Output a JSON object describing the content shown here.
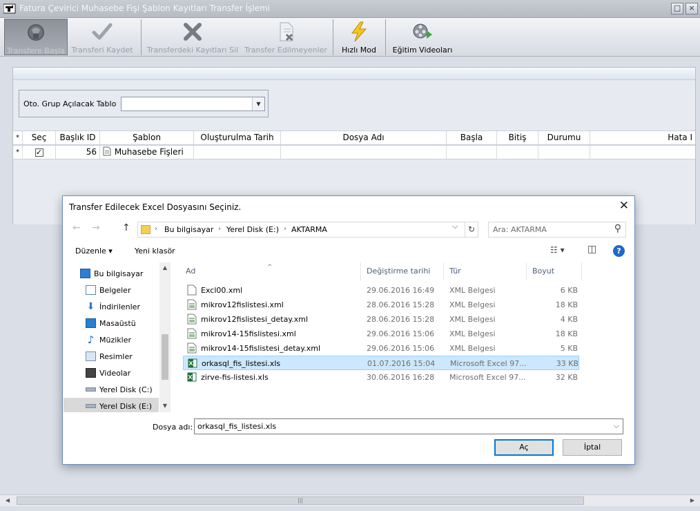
{
  "app": {
    "title": "Fatura Çevirici Muhasebe Fişi Şablon Kayıtları Transfer İşlemi",
    "restore_glyph": "□",
    "close_glyph": "×"
  },
  "toolbar": {
    "start_label": "Transfere Başla",
    "save_label": "Transferi Kaydet",
    "delete_label": "Transferdeki Kayıtları Sil",
    "not_transferred_label": "Transfer Edilmeyenler",
    "fast_mode_label": "Hızlı Mod",
    "videos_label": "Eğitim Videoları"
  },
  "filter": {
    "label": "Oto. Grup Açılacak Tablo",
    "value": "",
    "arrow_glyph": "▼"
  },
  "grid": {
    "columns": [
      "*",
      "Seç",
      "Başlık ID",
      "Şablon",
      "Oluşturulma Tarih",
      "Dosya Adı",
      "Başla",
      "Bitiş",
      "Durumu",
      "Hata I"
    ],
    "rows": [
      {
        "marker": "*",
        "checked": "✓",
        "id": "56",
        "template": "Muhasebe Fişleri",
        "created": "",
        "file": "",
        "start": "",
        "end": "",
        "status": "",
        "error": ""
      }
    ]
  },
  "app_scroll": {
    "left": "◀",
    "right": "▶",
    "grip": "|||"
  },
  "dialog": {
    "title": "Transfer Edilecek Excel Dosyasını Seçiniz.",
    "close_glyph": "✕",
    "nav": {
      "back": "←",
      "forward": "→",
      "up": "↑",
      "dropdown": "⌵",
      "refresh": "↻"
    },
    "breadcrumb": [
      "Bu bilgisayar",
      "Yerel Disk (E:)",
      "AKTARMA"
    ],
    "breadcrumb_sep": "›",
    "search_placeholder": "Ara: AKTARMA",
    "search_glyph": "⚲",
    "commands": {
      "organize": "Düzenle ▾",
      "new_folder": "Yeni klasör",
      "view": "☷ ▾",
      "pane": "◫",
      "help": "?"
    },
    "tree": [
      {
        "label": "Bu bilgisayar",
        "icon": "computer-icon",
        "color": "#2a7fd4"
      },
      {
        "label": "Belgeler",
        "icon": "documents-icon",
        "color": "#5a86b8"
      },
      {
        "label": "İndirilenler",
        "icon": "downloads-icon",
        "color": "#2a7fd4"
      },
      {
        "label": "Masaüstü",
        "icon": "desktop-icon",
        "color": "#2a7fd4"
      },
      {
        "label": "Müzikler",
        "icon": "music-icon",
        "color": "#1e69c8"
      },
      {
        "label": "Resimler",
        "icon": "pictures-icon",
        "color": "#6d8fb5"
      },
      {
        "label": "Videolar",
        "icon": "videos-icon",
        "color": "#444444"
      },
      {
        "label": "Yerel Disk (C:)",
        "icon": "drive-c-icon",
        "color": "#7a8899"
      },
      {
        "label": "Yerel Disk (E:)",
        "icon": "drive-e-icon",
        "color": "#7a8899"
      }
    ],
    "tree_scroll": {
      "up": "▲",
      "down": "▼"
    },
    "columns": {
      "name": "Ad",
      "modified": "Değiştirme tarihi",
      "type": "Tür",
      "size": "Boyut",
      "sort_caret": "^"
    },
    "files": [
      {
        "name": "Excl00.xml",
        "modified": "29.06.2016 16:49",
        "type": "XML Belgesi",
        "size": "6 KB",
        "kind": "xml"
      },
      {
        "name": "mikrov12fislistesi.xml",
        "modified": "28.06.2016 15:28",
        "type": "XML Belgesi",
        "size": "18 KB",
        "kind": "xml"
      },
      {
        "name": "mikrov12fislistesi_detay.xml",
        "modified": "28.06.2016 15:28",
        "type": "XML Belgesi",
        "size": "4 KB",
        "kind": "xml"
      },
      {
        "name": "mikrov14-15fislistesi.xml",
        "modified": "29.06.2016 15:06",
        "type": "XML Belgesi",
        "size": "18 KB",
        "kind": "xml"
      },
      {
        "name": "mikrov14-15fislistesi_detay.xml",
        "modified": "29.06.2016 15:06",
        "type": "XML Belgesi",
        "size": "5 KB",
        "kind": "xml"
      },
      {
        "name": "orkasql_fis_listesi.xls",
        "modified": "01.07.2016 15:04",
        "type": "Microsoft Excel 97...",
        "size": "33 KB",
        "kind": "xls"
      },
      {
        "name": "zirve-fis-listesi.xls",
        "modified": "30.06.2016 16:28",
        "type": "Microsoft Excel 97...",
        "size": "32 KB",
        "kind": "xls"
      }
    ],
    "filename_label": "Dosya adı:",
    "filename_value": "orkasql_fis_listesi.xls",
    "filename_dropdown": "⌵",
    "open_label": "Aç",
    "cancel_label": "İptal"
  }
}
